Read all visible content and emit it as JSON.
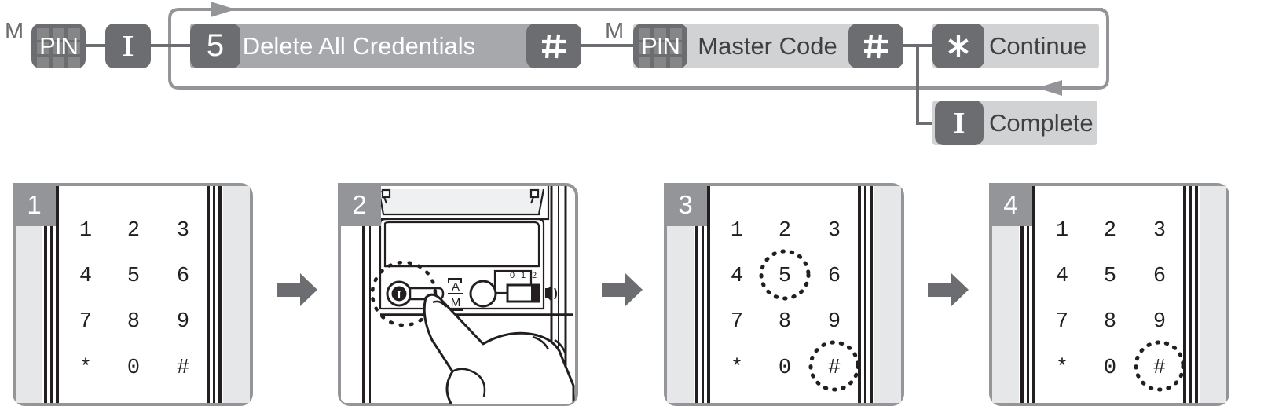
{
  "flow": {
    "m_marks": [
      {
        "id": "m-mark-1",
        "label": "M"
      },
      {
        "id": "m-mark-2",
        "label": "M"
      }
    ],
    "nodes": {
      "pin_1_label": "PIN",
      "enter_1_label": "I",
      "five_label": "5",
      "delete_all_label": "Delete All Credentials",
      "hash_1_label": "#",
      "pin_2_label": "PIN",
      "master_code_label": "Master Code",
      "hash_2_label": "#",
      "star_label": "*",
      "continue_label": "Continue",
      "enter_2_label": "I",
      "complete_label": "Complete"
    },
    "colors": {
      "badge_dark": "#6b6d70",
      "bar_mid": "#a6a8ab",
      "bar_light": "#d0d2d4",
      "line": "#939598",
      "text_dark": "#3f4042",
      "text_light": "#ffffff"
    },
    "loop": {
      "top_arrow_direction": "right",
      "bottom_arrow_direction": "left"
    }
  },
  "steps": [
    {
      "number": "1",
      "type": "keypad",
      "keys": [
        "1",
        "2",
        "3",
        "4",
        "5",
        "6",
        "7",
        "8",
        "9",
        "*",
        "0",
        "#"
      ],
      "highlighted": []
    },
    {
      "number": "2",
      "type": "lock-interior",
      "hand_action": "press-button",
      "highlighted_control": "enter-button",
      "controls": {
        "enter_button_label": "I",
        "mode_label_top": "A",
        "mode_label_bottom": "M",
        "volume_ticks": [
          "0",
          "1",
          "2"
        ],
        "volume_icon": "speaker-icon"
      }
    },
    {
      "number": "3",
      "type": "keypad",
      "keys": [
        "1",
        "2",
        "3",
        "4",
        "5",
        "6",
        "7",
        "8",
        "9",
        "*",
        "0",
        "#"
      ],
      "highlighted": [
        "5",
        "#"
      ]
    },
    {
      "number": "4",
      "type": "keypad",
      "keys": [
        "1",
        "2",
        "3",
        "4",
        "5",
        "6",
        "7",
        "8",
        "9",
        "*",
        "0",
        "#"
      ],
      "highlighted": [
        "#"
      ]
    }
  ],
  "step_arrows": [
    {
      "direction": "right"
    },
    {
      "direction": "right"
    },
    {
      "direction": "right"
    }
  ]
}
